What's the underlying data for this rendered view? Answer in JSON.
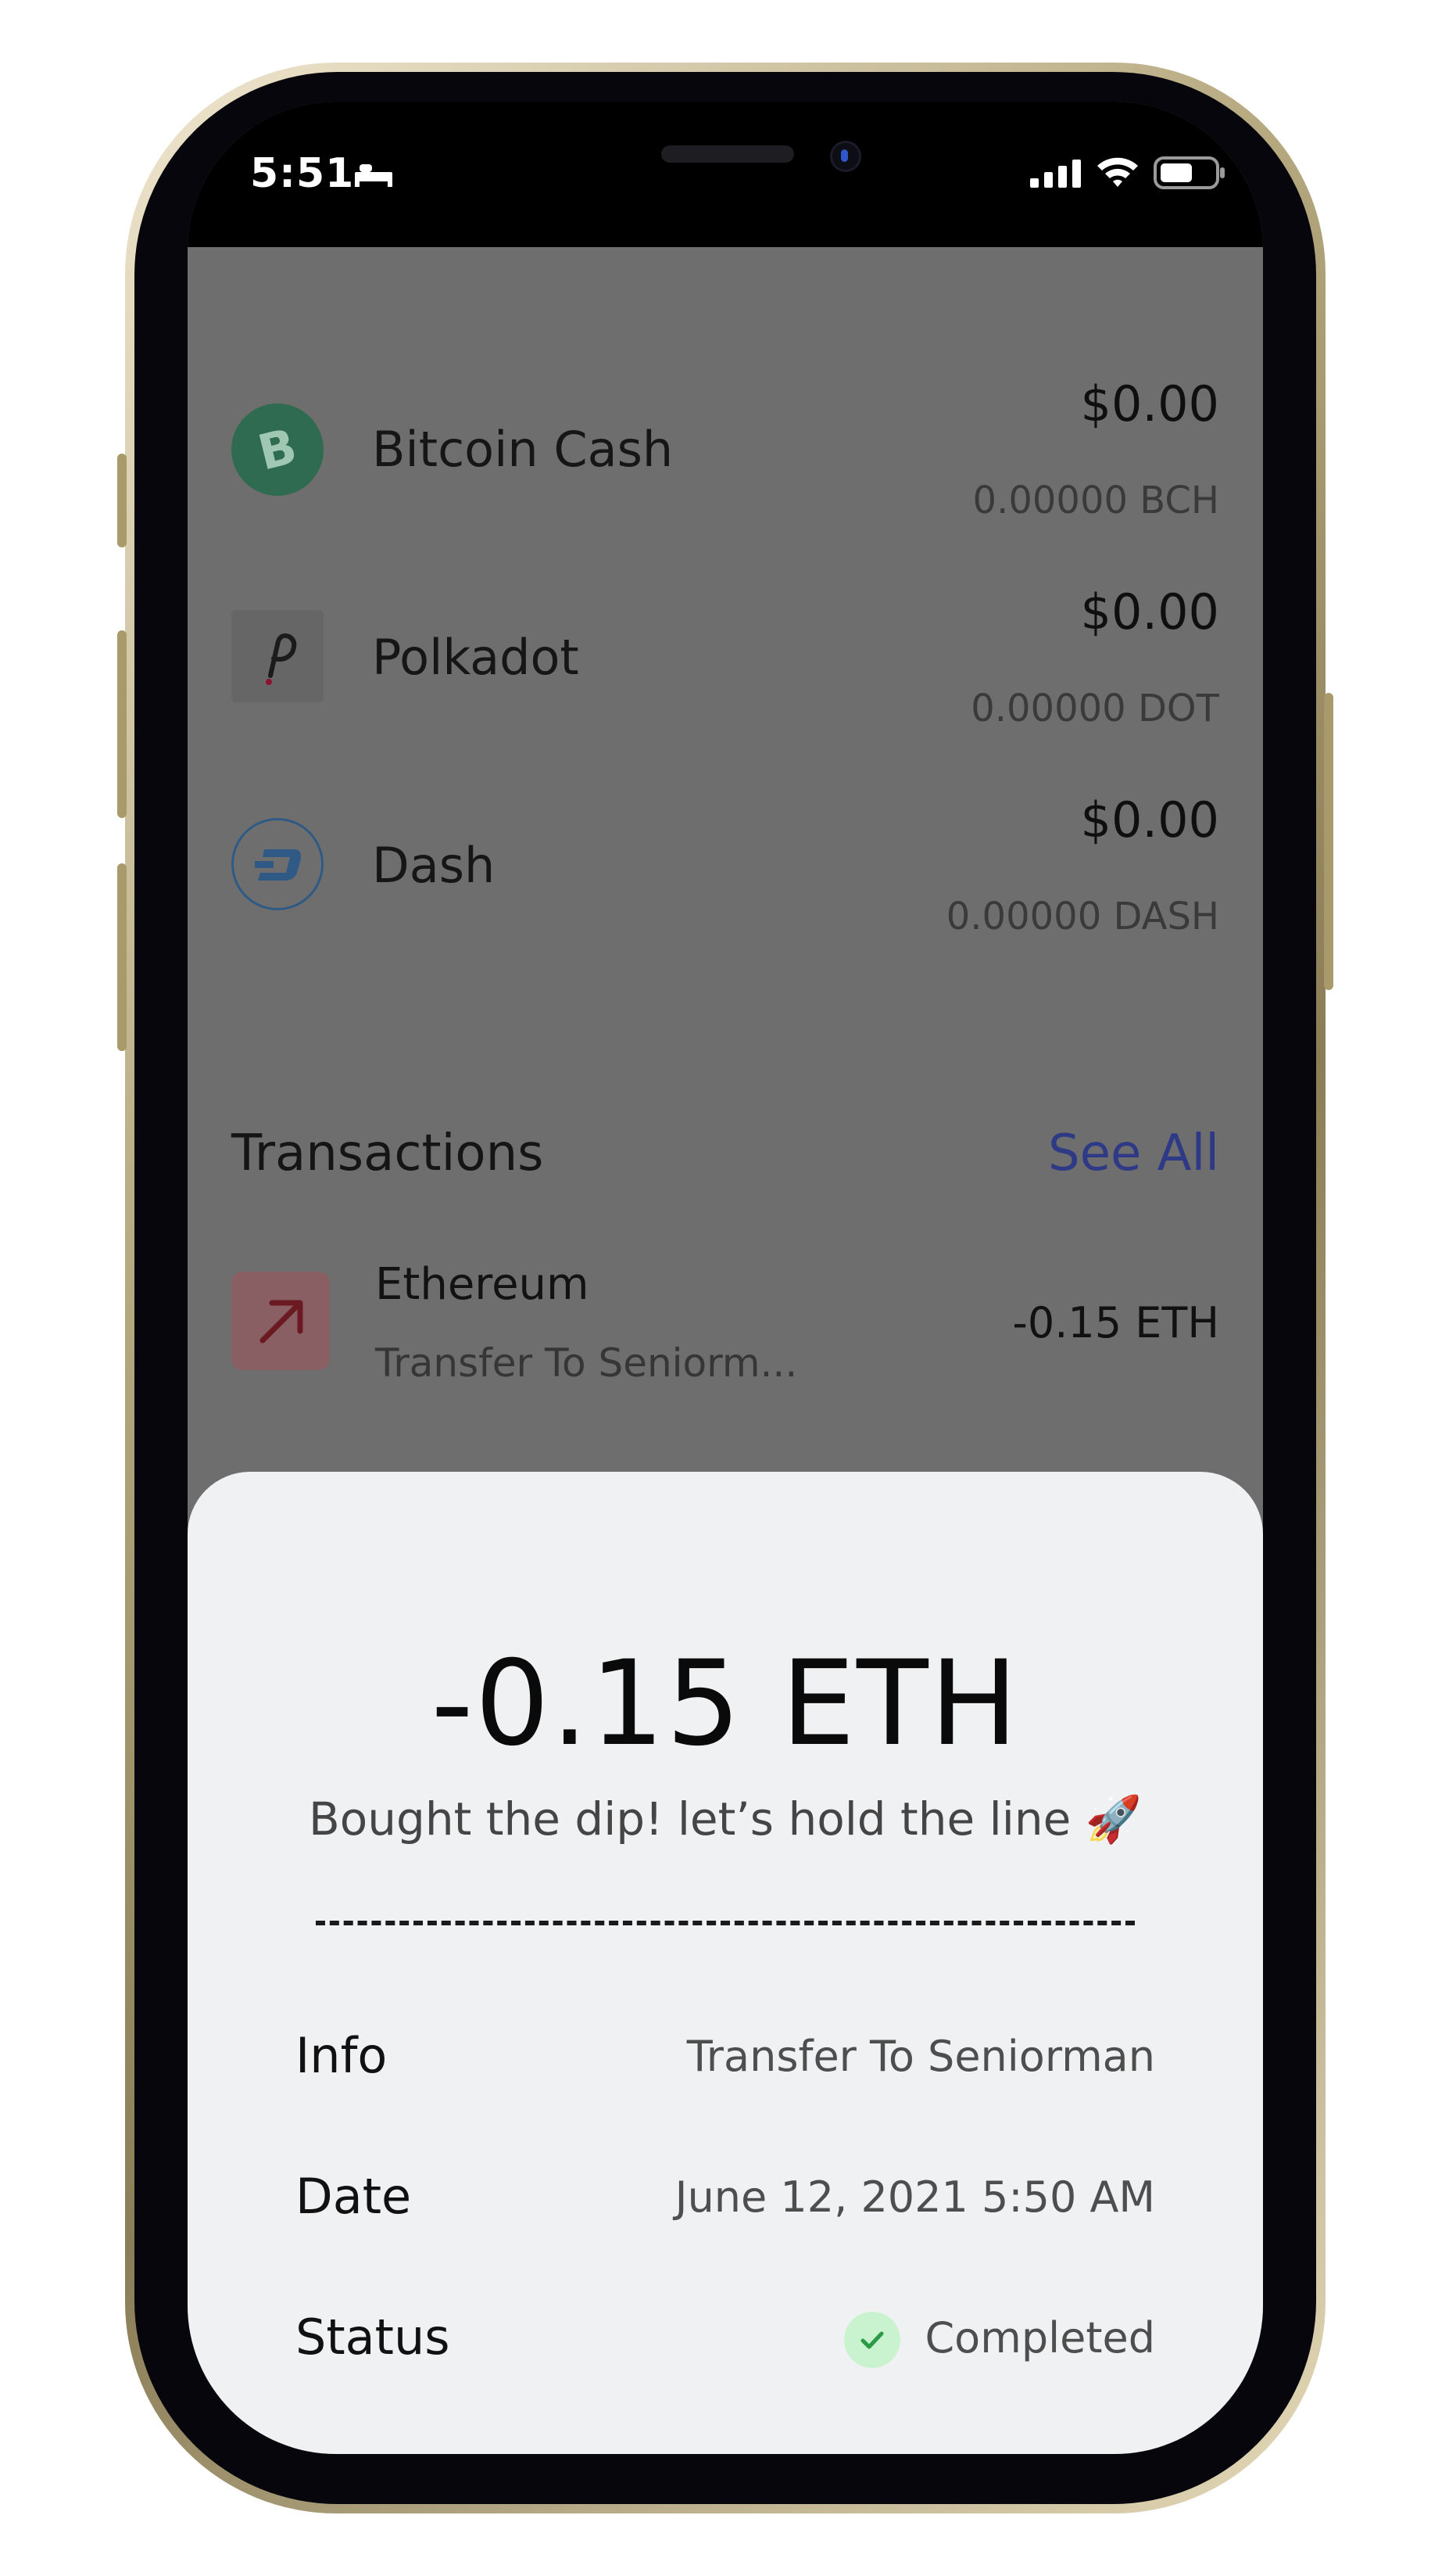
{
  "status_bar": {
    "time": "5:51"
  },
  "assets": [
    {
      "name": "Bitcoin Cash",
      "fiat": "$0.00",
      "qty": "0.00000 BCH",
      "icon": "bitcoin-cash-icon",
      "color": "#2f6b50"
    },
    {
      "name": "Polkadot",
      "fiat": "$0.00",
      "qty": "0.00000 DOT",
      "icon": "polkadot-icon",
      "color": "#5e5e5e"
    },
    {
      "name": "Dash",
      "fiat": "$0.00",
      "qty": "0.00000 DASH",
      "icon": "dash-icon",
      "color": "#2f5a86"
    }
  ],
  "transactions": {
    "title": "Transactions",
    "see_all": "See All",
    "items": [
      {
        "coin": "Ethereum",
        "desc": "Transfer To Seniorm...",
        "amount": "-0.15 ETH",
        "icon": "arrow-up-right-icon"
      }
    ]
  },
  "sheet": {
    "amount": "-0.15 ETH",
    "note": "Bought the dip! let’s hold the line 🚀",
    "details": [
      {
        "label": "Info",
        "value": "Transfer To Seniorman"
      },
      {
        "label": "Date",
        "value": "June 12, 2021 5:50 AM"
      },
      {
        "label": "Status",
        "value": "Completed",
        "icon": "check-icon"
      }
    ]
  },
  "colors": {
    "accent": "#2e3a86",
    "sheet_bg": "#f0f1f3",
    "overlay": "#6e6e6e",
    "completed_badge": "#c9f3cf",
    "send_icon": "#8a5f63"
  }
}
